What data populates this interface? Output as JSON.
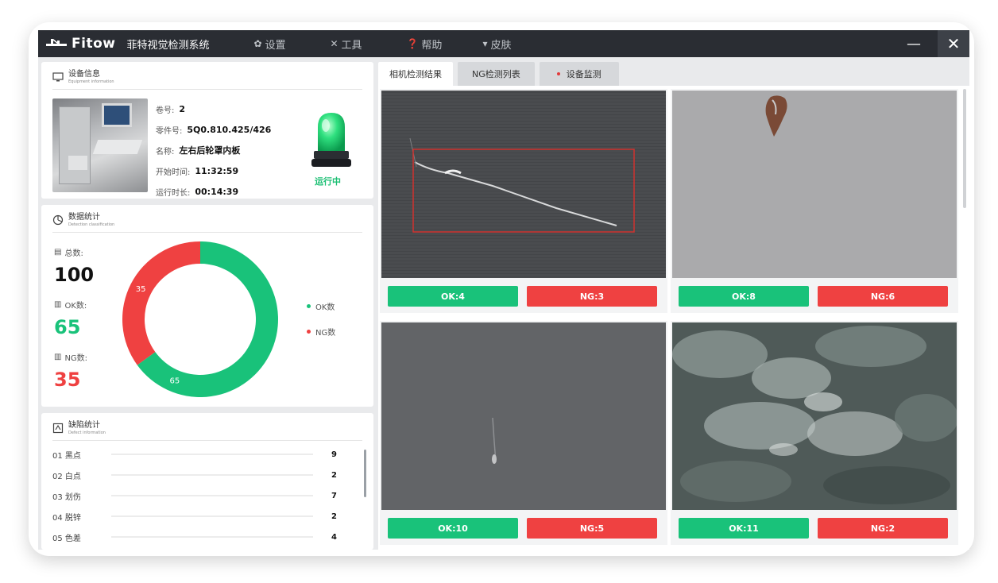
{
  "app": {
    "logo_text": "Fitow",
    "title": "菲特视觉检测系统",
    "menu": [
      {
        "label": "设置",
        "icon": "gear-icon"
      },
      {
        "label": "工具",
        "icon": "tools-icon"
      },
      {
        "label": "帮助",
        "icon": "help-icon"
      },
      {
        "label": "皮肤",
        "icon": "shirt-icon"
      }
    ],
    "minimize_glyph": "—",
    "close_glyph": "✕"
  },
  "equipment": {
    "title": "设备信息",
    "subtitle": "Equipment information",
    "rows": [
      {
        "label": "卷号:",
        "value": "2"
      },
      {
        "label": "零件号:",
        "value": "5Q0.810.425/426"
      },
      {
        "label": "名称:",
        "value": "左右后轮罩内板"
      },
      {
        "label": "开始时间:",
        "value": "11:32:59"
      },
      {
        "label": "运行时长:",
        "value": "00:14:39"
      }
    ],
    "status": "运行中",
    "status_color": "#1bbf73"
  },
  "stats": {
    "title": "数据统计",
    "subtitle": "Detection classification",
    "total_label": "总数:",
    "total": "100",
    "ok_label": "OK数:",
    "ok": "65",
    "ng_label": "NG数:",
    "ng": "35",
    "legend_ok": "OK数",
    "legend_ng": "NG数",
    "ok_color": "#19c27a",
    "ng_color": "#ef4141"
  },
  "chart_data": {
    "type": "pie",
    "categories": [
      "OK数",
      "NG数"
    ],
    "values": [
      65,
      35
    ],
    "data_labels": [
      "65",
      "35"
    ],
    "colors": [
      "#19c27a",
      "#ef4141"
    ],
    "legend": "right"
  },
  "defects": {
    "title": "缺陷统计",
    "subtitle": "Defect information",
    "items": [
      {
        "label": "01 黑点",
        "value": "9"
      },
      {
        "label": "02 白点",
        "value": "2"
      },
      {
        "label": "03 划伤",
        "value": "7"
      },
      {
        "label": "04 脱锌",
        "value": "2"
      },
      {
        "label": "05 色差",
        "value": "4"
      }
    ]
  },
  "tabs": [
    {
      "label": "相机检测结果",
      "active": true
    },
    {
      "label": "NG检测列表",
      "active": false
    },
    {
      "label": "设备监测",
      "active": false
    }
  ],
  "cameras": [
    {
      "ok": "OK:4",
      "ng": "NG:3"
    },
    {
      "ok": "OK:8",
      "ng": "NG:6"
    },
    {
      "ok": "OK:10",
      "ng": "NG:5"
    },
    {
      "ok": "OK:11",
      "ng": "NG:2"
    }
  ]
}
